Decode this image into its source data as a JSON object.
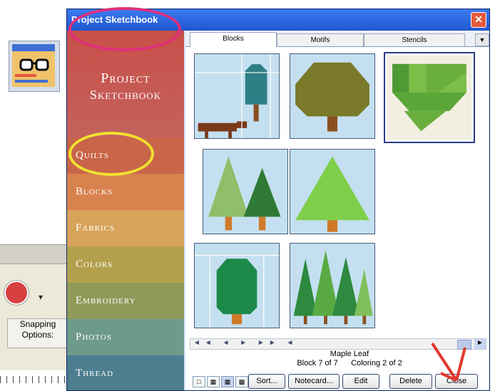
{
  "window": {
    "title": "Project Sketchbook",
    "close_glyph": "✕"
  },
  "sidebar": {
    "header_line1": "Project",
    "header_line2": "Sketchbook",
    "items": [
      {
        "label": "Quilts",
        "color": "#c96548"
      },
      {
        "label": "Blocks",
        "color": "#d8824e"
      },
      {
        "label": "Fabrics",
        "color": "#d7a35a"
      },
      {
        "label": "Colors",
        "color": "#b3a04d"
      },
      {
        "label": "Embroidery",
        "color": "#8e9a58"
      },
      {
        "label": "Photos",
        "color": "#6e9a8c"
      },
      {
        "label": "Thread",
        "color": "#4c7e90"
      }
    ]
  },
  "tabs": [
    "Blocks",
    "Motifs",
    "Stencils"
  ],
  "nav": {
    "glyphs": "◄◄ ◄ ► ►► ◄"
  },
  "info": {
    "name": "Maple Leaf",
    "block": "Block 7 of 7",
    "coloring": "Coloring 2 of 2"
  },
  "buttons": {
    "sort": "Sort...",
    "notecard": "Notecard...",
    "edit": "Edit",
    "delete": "Delete",
    "close": "Close"
  },
  "background_app": {
    "snapping_label": "Snapping Options:"
  },
  "colors": {
    "titlebar": "#1f56cf",
    "annotation_pink": "#e0307a",
    "annotation_yellow": "#f0e030",
    "arrow_red": "#e2382e"
  }
}
